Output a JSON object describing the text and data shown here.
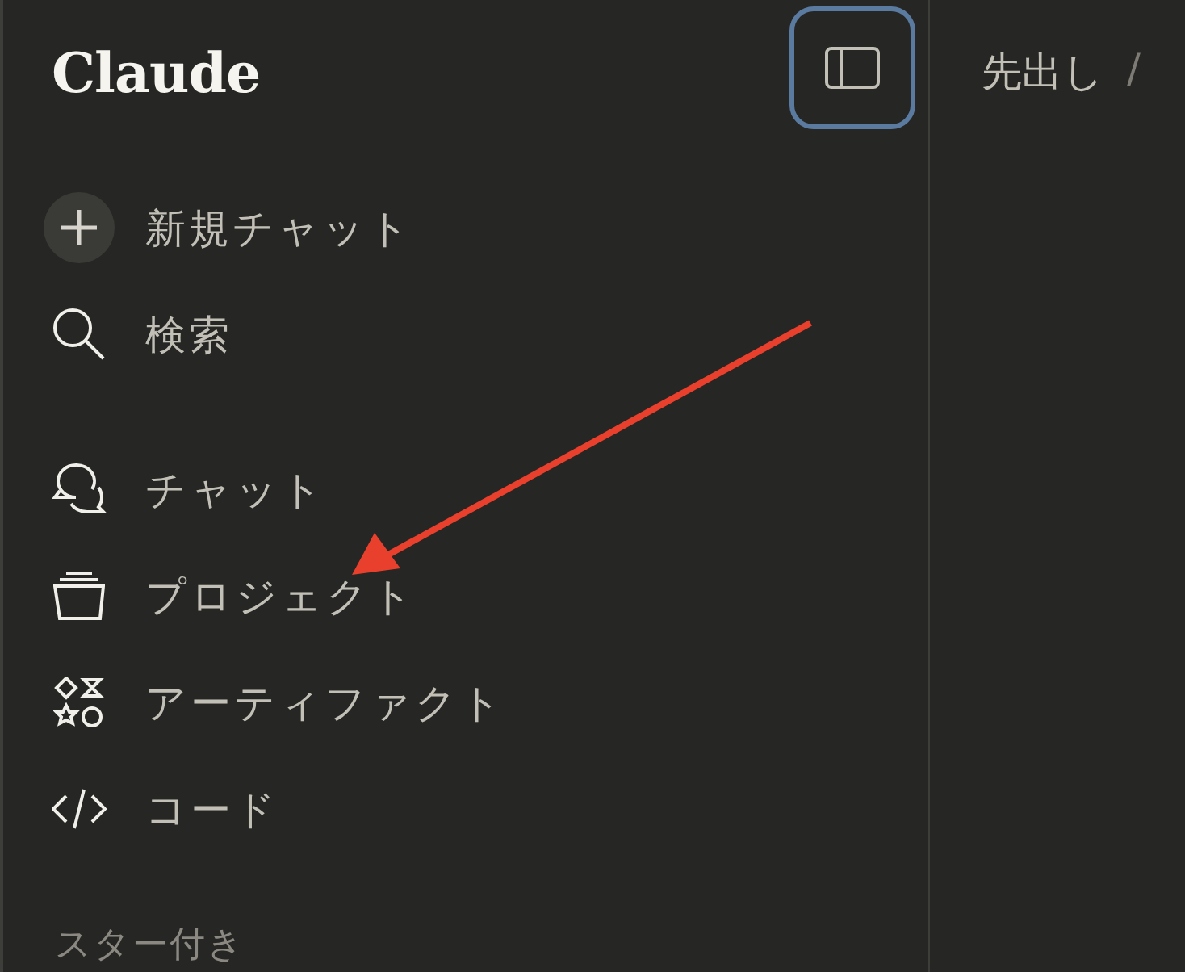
{
  "sidebar": {
    "logo": "Claude",
    "actions": [
      {
        "label": "新規チャット"
      },
      {
        "label": "検索"
      }
    ],
    "nav": [
      {
        "label": "チャット"
      },
      {
        "label": "プロジェクト"
      },
      {
        "label": "アーティファクト"
      },
      {
        "label": "コード"
      }
    ],
    "section_heading": "スター付き"
  },
  "main": {
    "breadcrumb": [
      "先出し",
      "/"
    ]
  }
}
